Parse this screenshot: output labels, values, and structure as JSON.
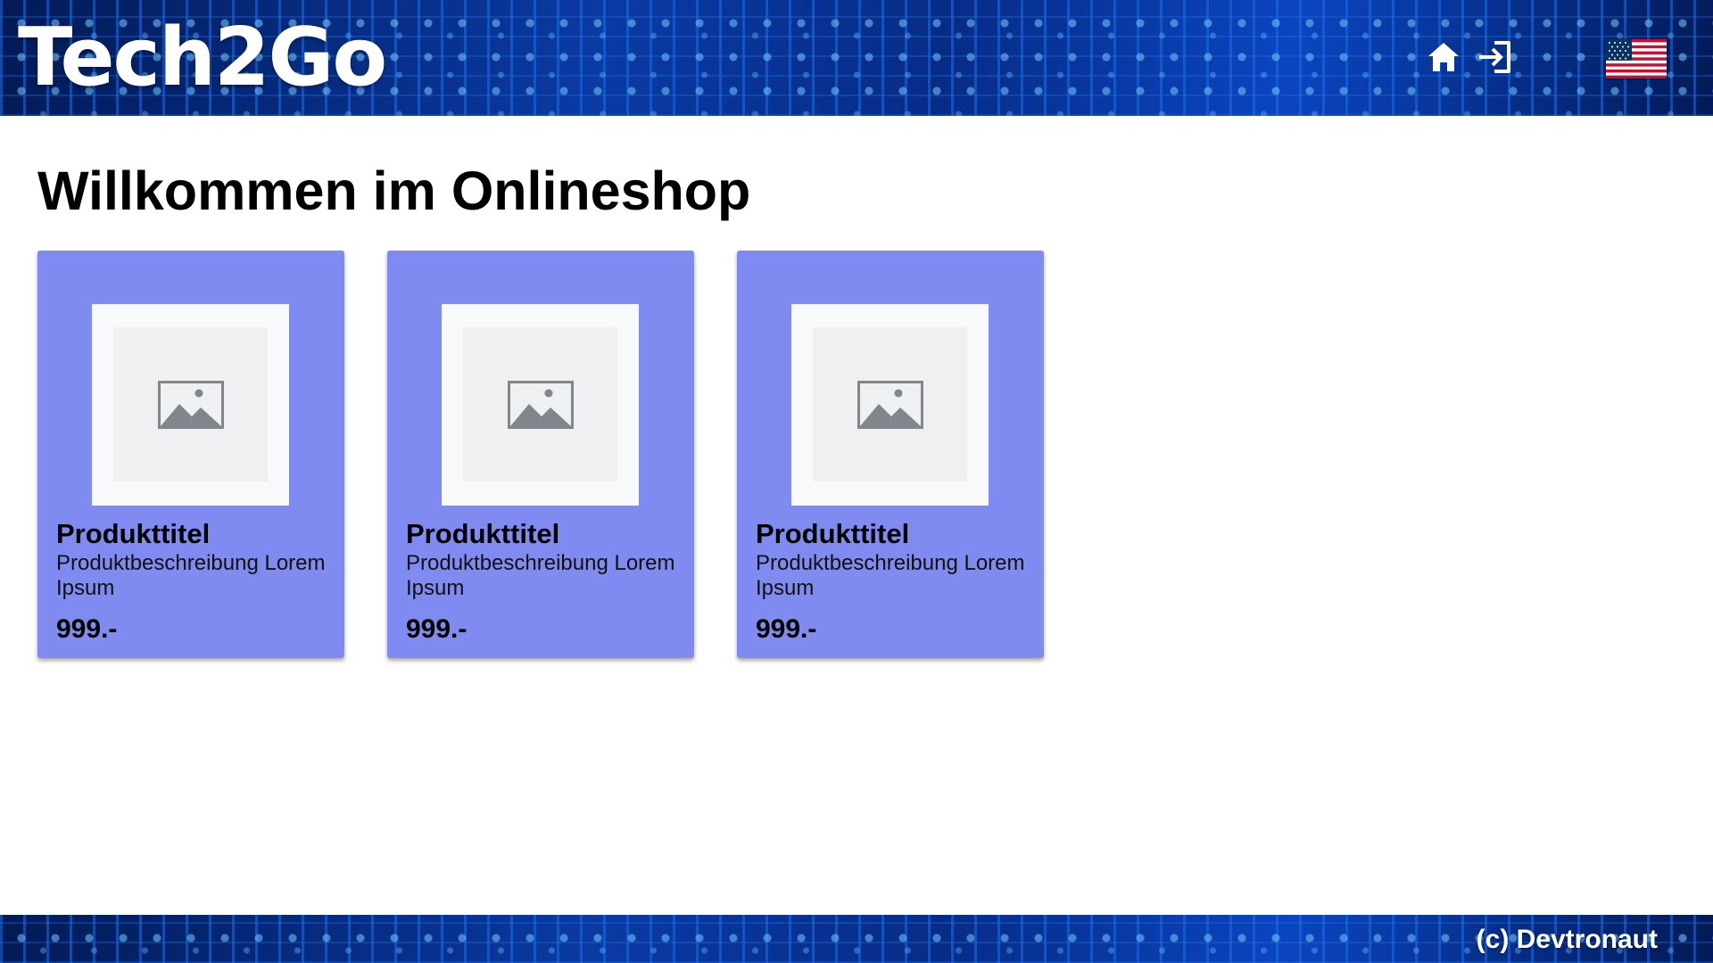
{
  "header": {
    "logo": "Tech2Go",
    "icons": [
      "home-icon",
      "login-icon",
      "us-flag-icon"
    ]
  },
  "main": {
    "title": "Willkommen im Onlineshop",
    "products": [
      {
        "title": "Produkttitel",
        "description": "Produktbeschreibung Lorem Ipsum",
        "price": "999.-",
        "image_icon": "image-placeholder-icon"
      },
      {
        "title": "Produkttitel",
        "description": "Produktbeschreibung Lorem Ipsum",
        "price": "999.-",
        "image_icon": "image-placeholder-icon"
      },
      {
        "title": "Produkttitel",
        "description": "Produktbeschreibung Lorem Ipsum",
        "price": "999.-",
        "image_icon": "image-placeholder-icon"
      }
    ]
  },
  "footer": {
    "copyright": "(c) Devtronaut"
  },
  "colors": {
    "header_bg": "#06246b",
    "card_bg": "#7f8bf1",
    "placeholder_bg": "#eef0f2",
    "placeholder_icon": "#80868b",
    "text": "#000000",
    "header_text": "#ffffff"
  }
}
